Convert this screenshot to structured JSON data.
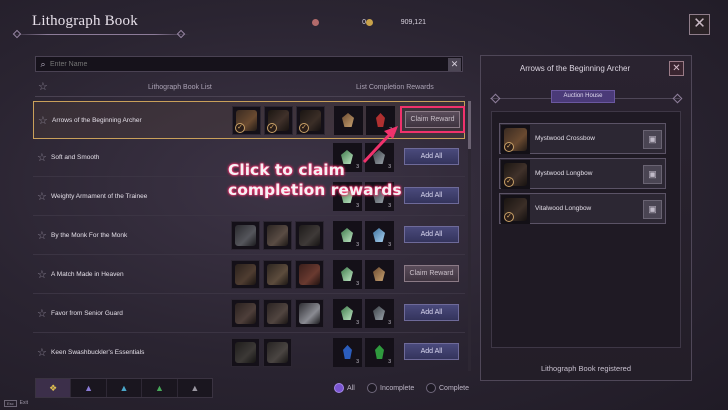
{
  "header": {
    "title": "Lithograph Book",
    "currency_1": "0",
    "currency_2": "909,121"
  },
  "search": {
    "placeholder": "Enter Name"
  },
  "columns": {
    "list": "Lithograph Book List",
    "rewards": "List Completion Rewards"
  },
  "rows": [
    {
      "name": "Arrows of the Beginning Archer",
      "button": "Claim Reward",
      "qty_1": "",
      "qty_2": "3"
    },
    {
      "name": "Soft and Smooth",
      "button": "Add All",
      "qty_1": "3",
      "qty_2": "3"
    },
    {
      "name": "Weighty Armament of the Trainee",
      "button": "Add All",
      "qty_1": "3",
      "qty_2": "3"
    },
    {
      "name": "By the Monk For the Monk",
      "button": "Add All",
      "qty_1": "3",
      "qty_2": "3"
    },
    {
      "name": "A Match Made in Heaven",
      "button": "Claim Reward",
      "qty_1": "3",
      "qty_2": ""
    },
    {
      "name": "Favor from Senior Guard",
      "button": "Add All",
      "qty_1": "3",
      "qty_2": "3"
    },
    {
      "name": "Keen Swashbuckler's Essentials",
      "button": "Add All",
      "qty_1": "3",
      "qty_2": "3"
    }
  ],
  "filters": {
    "all": "All",
    "incomplete": "Incomplete",
    "complete": "Complete"
  },
  "footer": {
    "key": "Esc",
    "label": "Exit"
  },
  "panel": {
    "title": "Arrows of the Beginning Archer",
    "auction_house": "Auction House",
    "items": [
      "Mystwood Crossbow",
      "Mystwood Longbow",
      "Vitalwood Longbow"
    ],
    "status": "Lithograph Book registered"
  },
  "callout": {
    "line1": "Click to claim",
    "line2": "completion rewards"
  },
  "icons": {
    "search": "search-icon",
    "close": "close-icon",
    "star": "star-icon",
    "check": "check-icon"
  },
  "colors": {
    "highlight": "#f0326c",
    "accent": "#4a3a78",
    "selected_border": "#c9a05a"
  }
}
